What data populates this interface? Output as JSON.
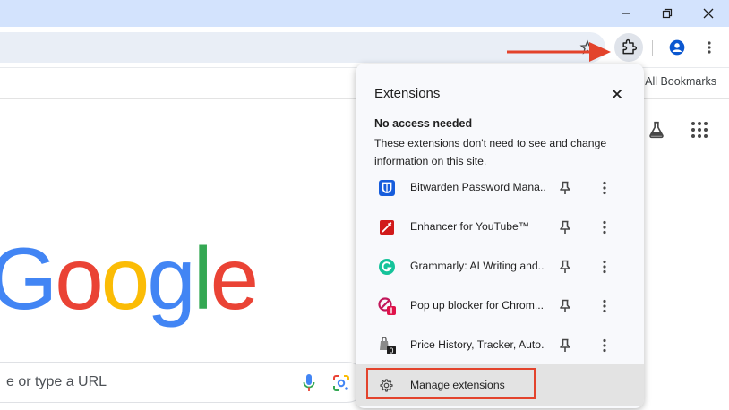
{
  "window_controls": {
    "minimize": "minimize",
    "restore": "restore",
    "close": "close"
  },
  "toolbar": {
    "bookmark_star": "star-icon",
    "extensions_button": "puzzle-icon",
    "profile": "person-icon",
    "menu": "vertical-dots-icon"
  },
  "bookmarks_bar": {
    "all_bookmarks": "All Bookmarks"
  },
  "newtab": {
    "logo": [
      "G",
      "o",
      "o",
      "g",
      "l",
      "e"
    ],
    "logo_colors": [
      "#4285f4",
      "#ea4335",
      "#fbbc05",
      "#4285f4",
      "#34a853",
      "#ea4335"
    ],
    "search_placeholder": "e or type a URL"
  },
  "extensions_popup": {
    "title": "Extensions",
    "section_heading": "No access needed",
    "section_description": "These extensions don't need to see and change information on this site.",
    "items": [
      {
        "name": "Bitwarden Password Mana...",
        "icon": "bitwarden-icon"
      },
      {
        "name": "Enhancer for YouTube™",
        "icon": "enhancer-icon"
      },
      {
        "name": "Grammarly: AI Writing and...",
        "icon": "grammarly-icon"
      },
      {
        "name": "Pop up blocker for Chrom...",
        "icon": "popup-blocker-icon"
      },
      {
        "name": "Price History, Tracker, Auto...",
        "icon": "price-history-icon"
      }
    ],
    "manage_label": "Manage extensions"
  },
  "colors": {
    "accent_red": "#e3432c",
    "titlebar": "#d3e3fd"
  }
}
